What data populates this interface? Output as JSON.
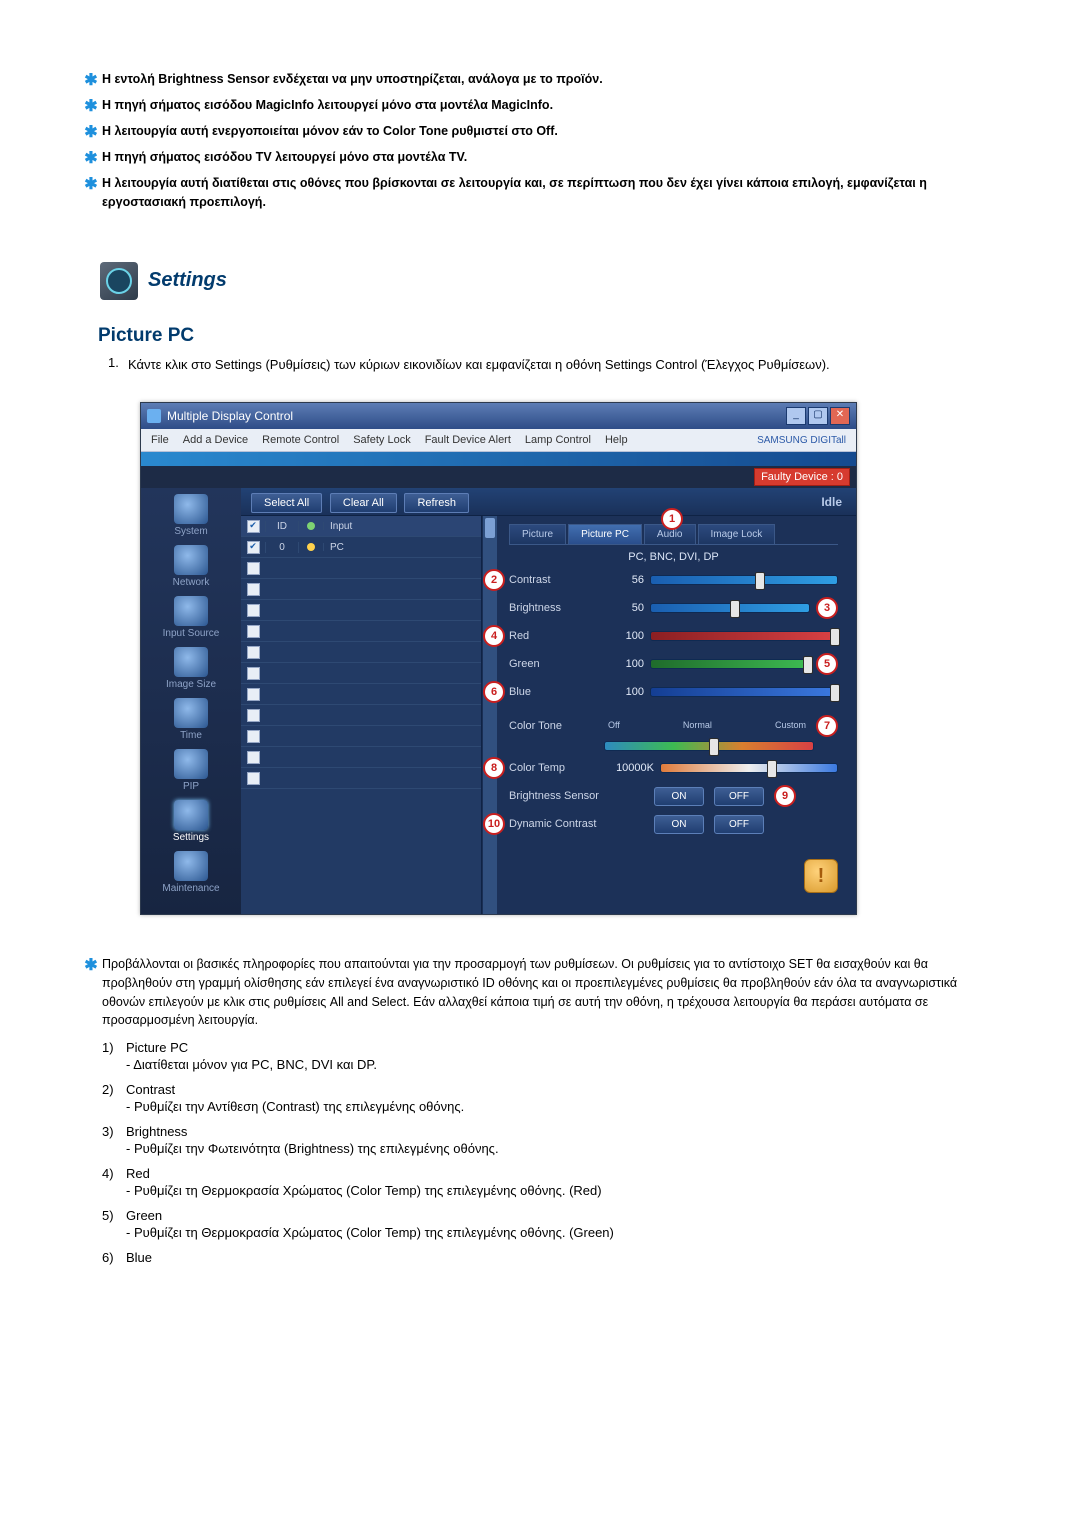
{
  "bullets": [
    "Η εντολή Brightness Sensor ενδέχεται να μην υποστηρίζεται, ανάλογα με το προϊόν.",
    "Η πηγή σήματος εισόδου MagicInfo λειτουργεί μόνο στα μοντέλα MagicInfo.",
    "Η λειτουργία αυτή ενεργοποιείται μόνον εάν το Color Tone ρυθμιστεί στο Off.",
    "Η πηγή σήματος εισόδου TV λειτουργεί μόνο στα μοντέλα TV.",
    "Η λειτουργία αυτή διατίθεται στις οθόνες που βρίσκονται σε λειτουργία και, σε περίπτωση που δεν έχει γίνει κάποια επιλογή, εμφανίζεται η εργοστασιακή προεπιλογή."
  ],
  "settings_heading": "Settings",
  "section_heading": "Picture PC",
  "step1": "1.",
  "step1_text": "Κάντε κλικ στο Settings (Ρυθμίσεις) των κύριων εικονιδίων και εμφανίζεται η οθόνη Settings Control (Έλεγχος Ρυθμίσεων).",
  "window": {
    "title": "Multiple Display Control",
    "menu": [
      "File",
      "Add a Device",
      "Remote Control",
      "Safety Lock",
      "Fault Device Alert",
      "Lamp Control",
      "Help"
    ],
    "brand": "SAMSUNG DIGITall",
    "faulty": "Faulty Device : 0",
    "toolbar": {
      "select_all": "Select All",
      "clear_all": "Clear All",
      "refresh": "Refresh",
      "idle": "Idle"
    },
    "sidebar": [
      "System",
      "Network",
      "Input Source",
      "Image Size",
      "Time",
      "PIP",
      "Settings",
      "Maintenance"
    ],
    "grid": {
      "h_id": "ID",
      "h_input": "Input",
      "row0_id": "0",
      "row0_input": "PC"
    },
    "tabs": {
      "picture": "Picture",
      "picture_pc": "Picture PC",
      "audio": "Audio",
      "image_lock": "Image Lock"
    },
    "subheader": "PC, BNC, DVI, DP",
    "labels": {
      "contrast": "Contrast",
      "brightness": "Brightness",
      "red": "Red",
      "green": "Green",
      "blue": "Blue",
      "colortone": "Color Tone",
      "colortemp": "Color Temp",
      "brightsensor": "Brightness Sensor",
      "dyncontrast": "Dynamic Contrast"
    },
    "values": {
      "contrast": "56",
      "brightness": "50",
      "red": "100",
      "green": "100",
      "blue": "100",
      "colortemp": "10000K"
    },
    "scale": {
      "off": "Off",
      "normal": "Normal",
      "custom": "Custom"
    },
    "btn": {
      "on": "ON",
      "off": "OFF"
    }
  },
  "footinfo": "Προβάλλονται οι βασικές πληροφορίες που απαιτούνται για την προσαρμογή των ρυθμίσεων. Οι ρυθμίσεις για το αντίστοιχο SET θα εισαχθούν και θα προβληθούν στη γραμμή ολίσθησης εάν επιλεγεί ένα αναγνωριστικό ID οθόνης και οι προεπιλεγμένες ρυθμίσεις θα προβληθούν εάν όλα τα αναγνωριστικά οθονών επιλεγούν με κλικ στις ρυθμίσεις All and Select. Εάν αλλαχθεί κάποια τιμή σε αυτή την οθόνη, η τρέχουσα λειτουργία θα περάσει αυτόματα σε προσαρμοσμένη λειτουργία.",
  "notes": [
    {
      "n": "1)",
      "t": "Picture PC",
      "sub": "- Διατίθεται μόνον για PC, BNC, DVI και DP."
    },
    {
      "n": "2)",
      "t": "Contrast",
      "sub": "- Ρυθμίζει την Αντίθεση (Contrast) της επιλεγμένης οθόνης."
    },
    {
      "n": "3)",
      "t": "Brightness",
      "sub": "- Ρυθμίζει την Φωτεινότητα (Brightness) της επιλεγμένης οθόνης."
    },
    {
      "n": "4)",
      "t": "Red",
      "sub": "- Ρυθμίζει τη Θερμοκρασία Χρώματος (Color Temp) της επιλεγμένης οθόνης. (Red)"
    },
    {
      "n": "5)",
      "t": "Green",
      "sub": "- Ρυθμίζει τη Θερμοκρασία Χρώματος (Color Temp) της επιλεγμένης οθόνης. (Green)"
    },
    {
      "n": "6)",
      "t": "Blue",
      "sub": ""
    }
  ]
}
